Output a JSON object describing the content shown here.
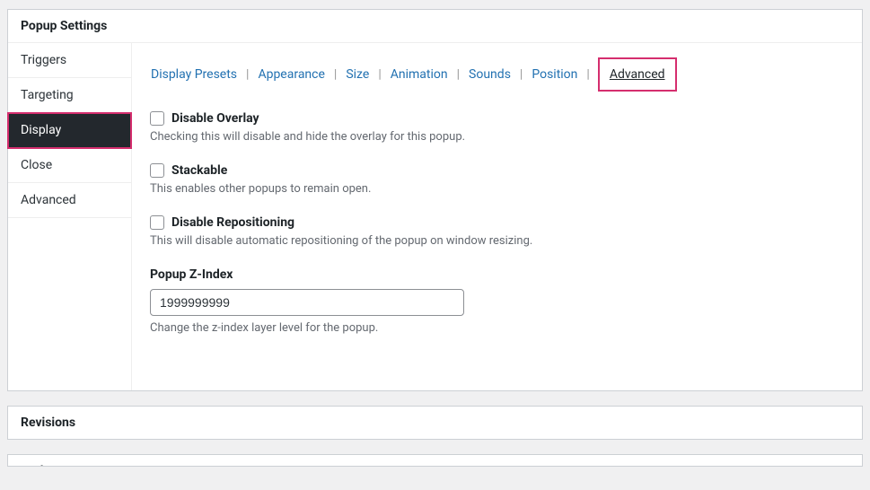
{
  "popup_settings": {
    "title": "Popup Settings",
    "vtabs": [
      "Triggers",
      "Targeting",
      "Display",
      "Close",
      "Advanced"
    ],
    "htabs": [
      "Display Presets",
      "Appearance",
      "Size",
      "Animation",
      "Sounds",
      "Position",
      "Advanced"
    ],
    "settings": {
      "disable_overlay": {
        "label": "Disable Overlay",
        "desc": "Checking this will disable and hide the overlay for this popup."
      },
      "stackable": {
        "label": "Stackable",
        "desc": "This enables other popups to remain open."
      },
      "disable_repositioning": {
        "label": "Disable Repositioning",
        "desc": "This will disable automatic repositioning of the popup on window resizing."
      },
      "zindex": {
        "label": "Popup Z-Index",
        "value": "1999999999",
        "desc": "Change the z-index layer level for the popup."
      }
    }
  },
  "revisions": {
    "title": "Revisions"
  },
  "author": {
    "title": "Author"
  }
}
